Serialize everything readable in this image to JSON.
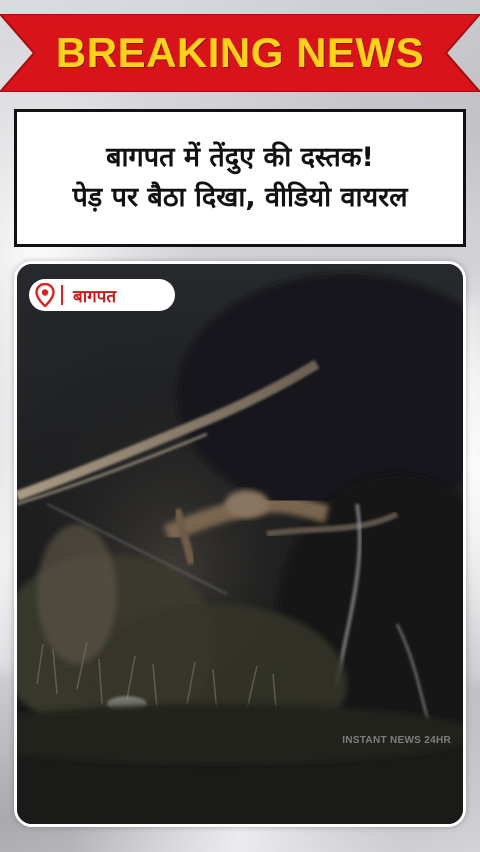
{
  "banner": {
    "label": "BREAKING NEWS",
    "ribbon_color": "#d8141a",
    "text_color": "#ffd21a"
  },
  "headline": {
    "line1": "बागपत में तेंदुए की दस्तक!",
    "line2": "पेड़ पर बैठा दिखा, वीडियो वायरल"
  },
  "video": {
    "location_icon": "location-pin-icon",
    "location_label": "बागपत",
    "watermark": "INSTANT NEWS 24HR"
  }
}
